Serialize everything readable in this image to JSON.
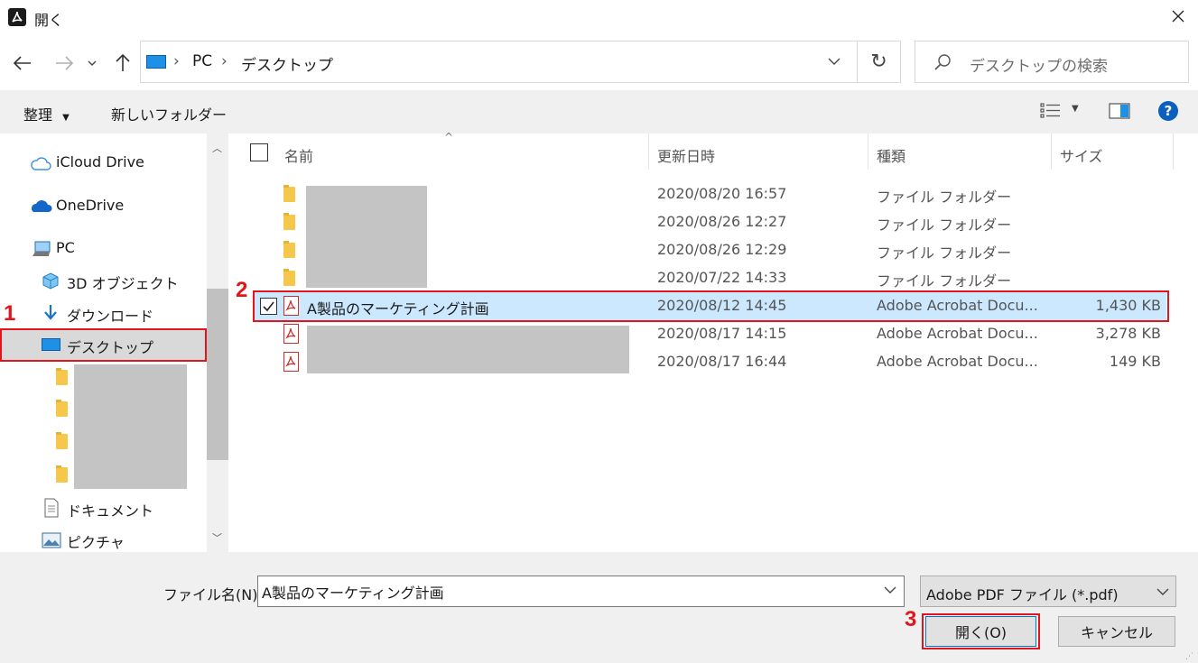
{
  "window": {
    "title": "開く"
  },
  "address": {
    "crumbs": [
      "PC",
      "デスクトップ"
    ],
    "search_placeholder": "デスクトップの検索"
  },
  "toolbar": {
    "organize_label": "整理",
    "new_folder_label": "新しいフォルダー"
  },
  "sidebar": {
    "items": [
      {
        "label": "iCloud Drive"
      },
      {
        "label": "OneDrive"
      },
      {
        "label": "PC"
      },
      {
        "label": "3D オブジェクト"
      },
      {
        "label": "ダウンロード"
      },
      {
        "label": "デスクトップ"
      },
      {
        "label": "ドキュメント"
      },
      {
        "label": "ピクチャ"
      }
    ]
  },
  "columns": {
    "name": "名前",
    "modified": "更新日時",
    "type": "種類",
    "size": "サイズ"
  },
  "files": [
    {
      "kind": "folder",
      "name": "",
      "modified": "2020/08/20 16:57",
      "type": "ファイル フォルダー",
      "size": ""
    },
    {
      "kind": "folder",
      "name": "",
      "modified": "2020/08/26 12:27",
      "type": "ファイル フォルダー",
      "size": ""
    },
    {
      "kind": "folder",
      "name": "",
      "modified": "2020/08/26 12:29",
      "type": "ファイル フォルダー",
      "size": ""
    },
    {
      "kind": "folder",
      "name": "",
      "modified": "2020/07/22 14:33",
      "type": "ファイル フォルダー",
      "size": ""
    },
    {
      "kind": "pdf",
      "name": "A製品のマーケティング計画",
      "modified": "2020/08/12 14:45",
      "type": "Adobe Acrobat Docu...",
      "size": "1,430 KB",
      "selected": true
    },
    {
      "kind": "pdf",
      "name": "",
      "modified": "2020/08/17 14:15",
      "type": "Adobe Acrobat Docu...",
      "size": "3,278 KB"
    },
    {
      "kind": "pdf",
      "name": "",
      "modified": "2020/08/17 16:44",
      "type": "Adobe Acrobat Docu...",
      "size": "149 KB"
    }
  ],
  "bottom": {
    "filename_label": "ファイル名(N):",
    "filename_value": "A製品のマーケティング計画",
    "filetype_value": "Adobe PDF ファイル (*.pdf)",
    "open_label": "開く(O)",
    "cancel_label": "キャンセル"
  },
  "annotations": {
    "step1": "1",
    "step2": "2",
    "step3": "3"
  },
  "colors": {
    "accent_red": "#e0161c",
    "selection": "#cce8ff",
    "pc_blue": "#1e90e6"
  }
}
